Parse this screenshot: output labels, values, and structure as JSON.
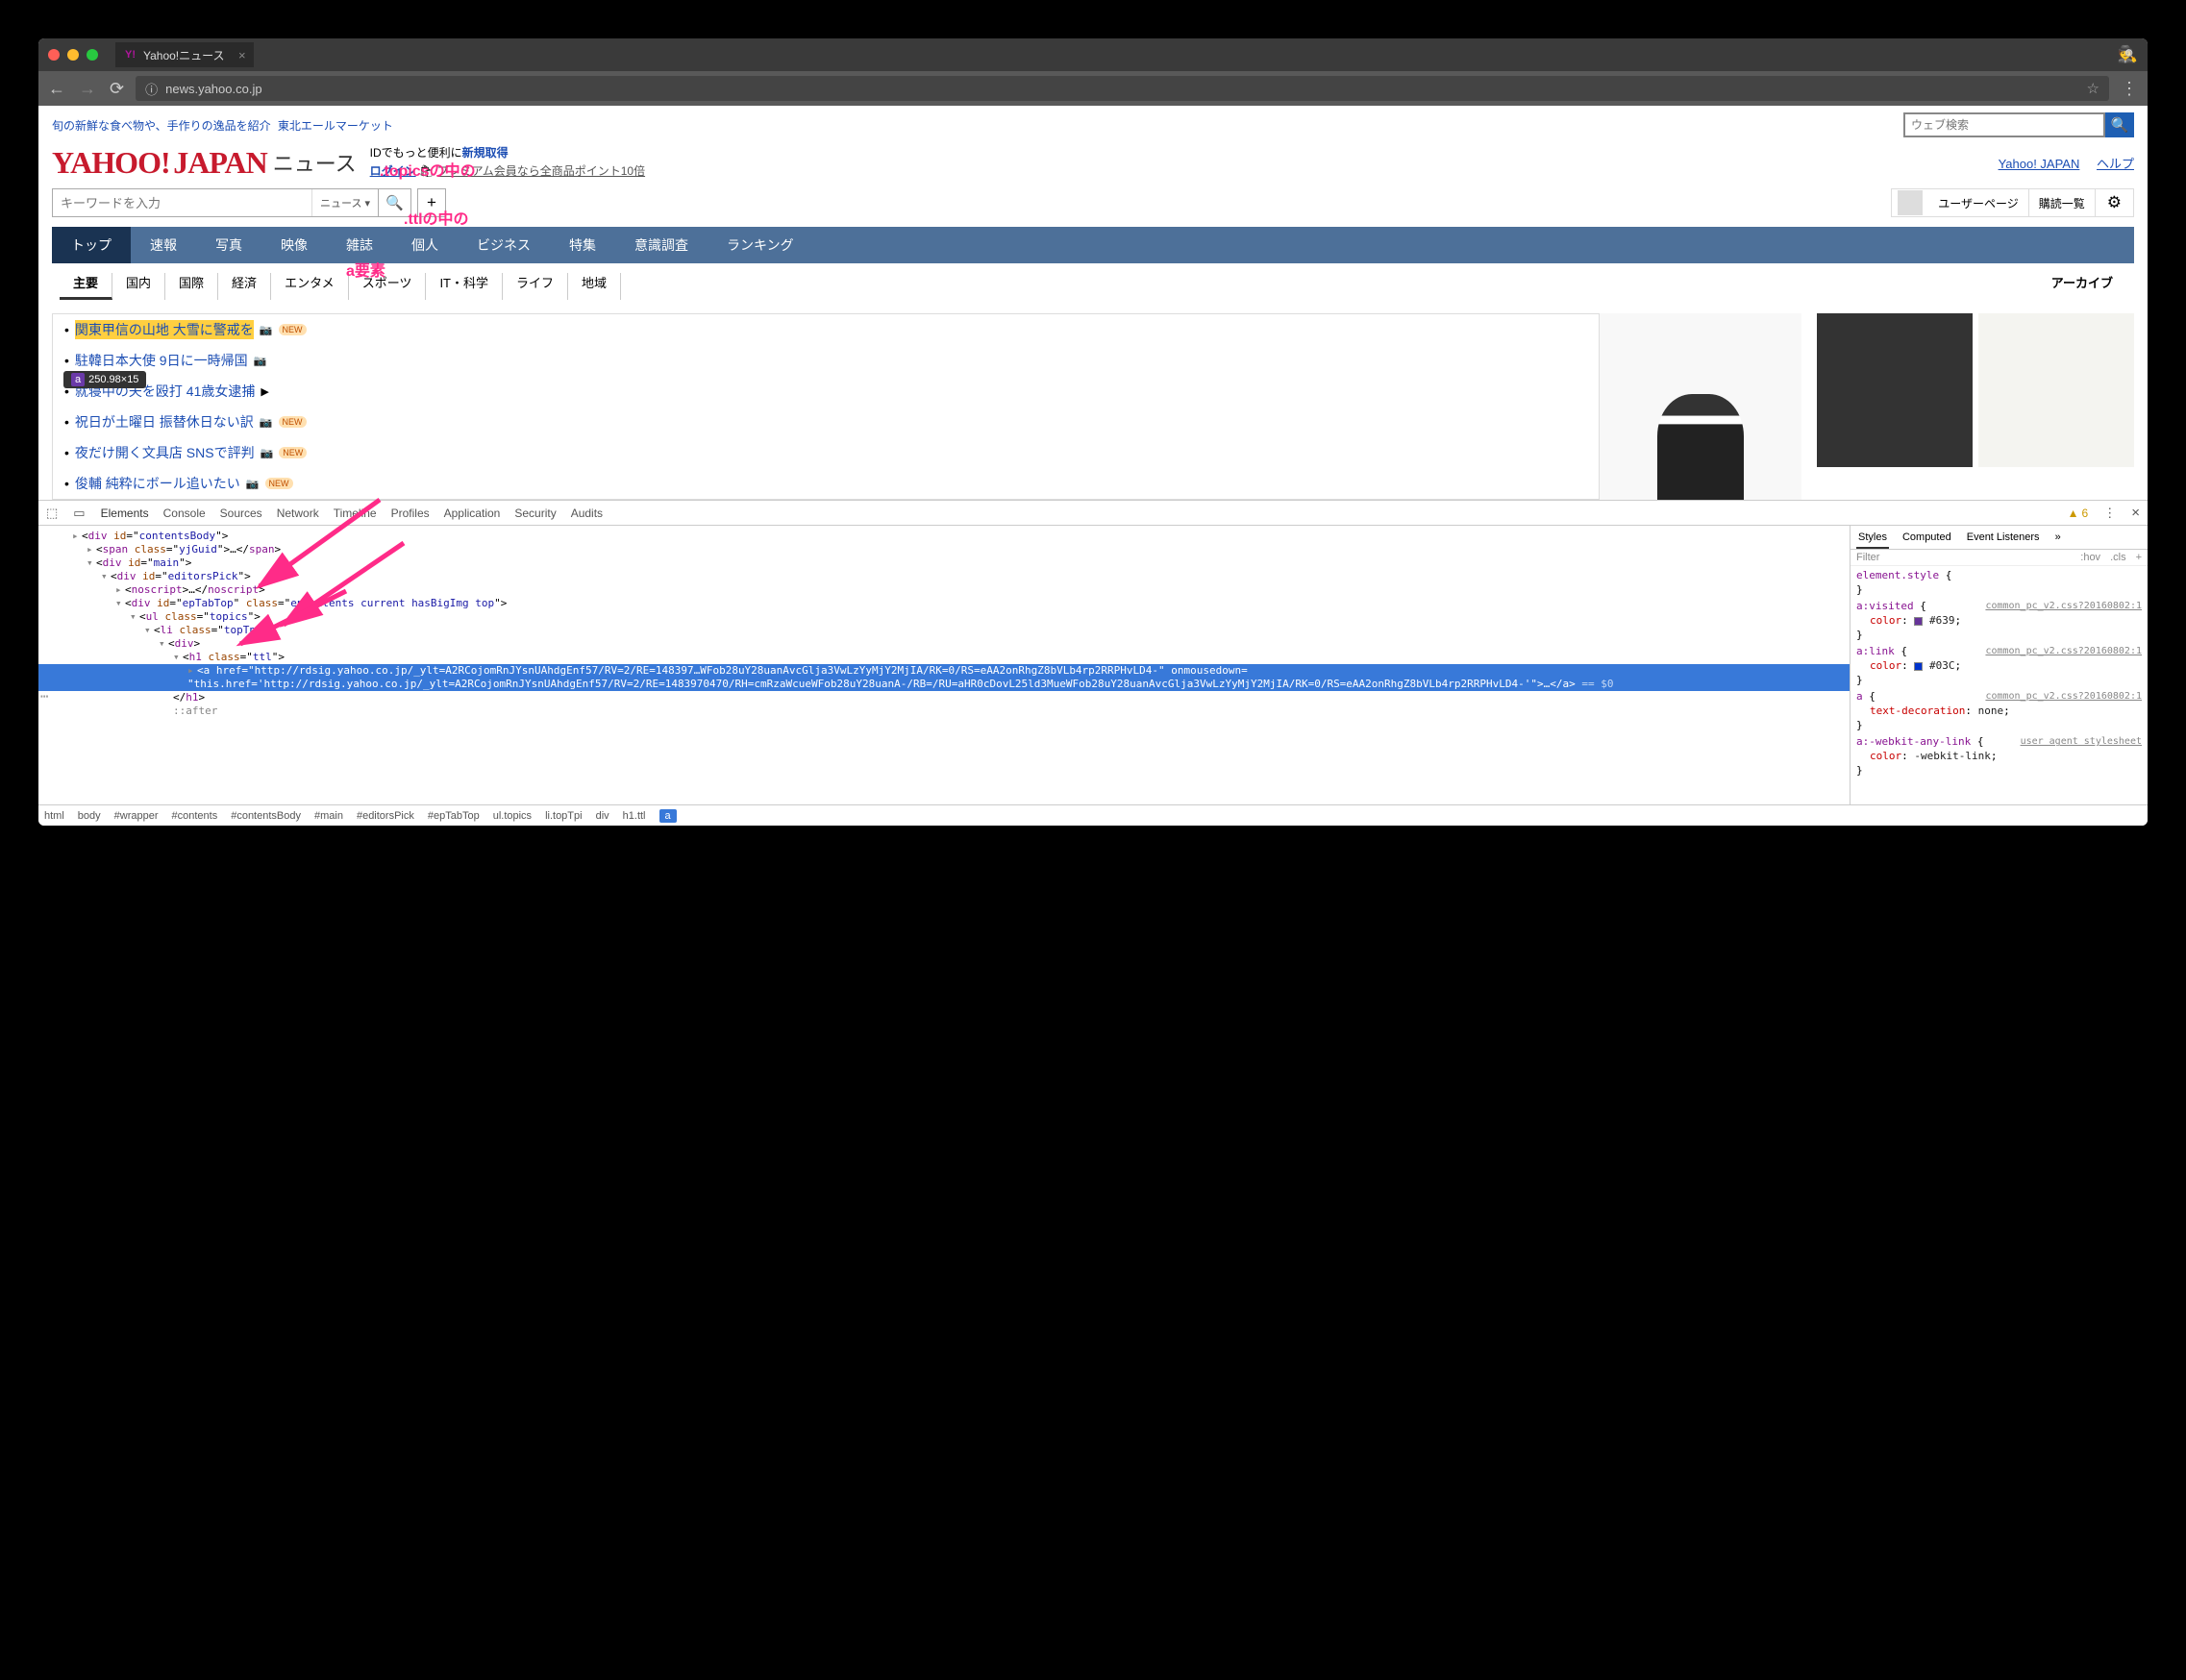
{
  "chrome": {
    "tab_title": "Yahoo!ニュース",
    "url": "news.yahoo.co.jp",
    "dots": [
      "#ff5f57",
      "#febc2e",
      "#28c840"
    ]
  },
  "top_links": [
    "旬の新鮮な食べ物や、手作りの逸品を紹介",
    "東北エールマーケット"
  ],
  "search_placeholder": "ウェブ検索",
  "logo_text": "YAHOO!",
  "logo_sub": "JAPAN",
  "news_label": "ニュース",
  "id_line1_a": "IDでもっと便利に",
  "id_line1_b": "新規取得",
  "id_line2_a": "ログイン",
  "id_line2_b": "プレミアム会員なら全商品ポイント10倍",
  "header_right": [
    "Yahoo! JAPAN",
    "ヘルプ"
  ],
  "keyword_placeholder": "キーワードを入力",
  "search_drop": "ニュース",
  "user_menu": [
    "ユーザーページ",
    "購読一覧"
  ],
  "main_nav": [
    "トップ",
    "速報",
    "写真",
    "映像",
    "雑誌",
    "個人",
    "ビジネス",
    "特集",
    "意識調査",
    "ランキング"
  ],
  "sub_nav": [
    "主要",
    "国内",
    "国際",
    "経済",
    "エンタメ",
    "スポーツ",
    "IT・科学",
    "ライフ",
    "地域"
  ],
  "archive": "アーカイブ",
  "tooltip": {
    "tag": "a",
    "dims": "250.98×15"
  },
  "news": [
    {
      "t": "関東甲信の山地 大雪に警戒を",
      "cam": true,
      "new": true,
      "sel": true
    },
    {
      "t": "駐韓日本大使 9日に一時帰国",
      "cam": true
    },
    {
      "t": "就寝中の夫を殴打 41歳女逮捕",
      "vid": true
    },
    {
      "t": "祝日が土曜日 振替休日ない訳",
      "cam": true,
      "new": true
    },
    {
      "t": "夜だけ開く文具店 SNSで評判",
      "cam": true,
      "new": true
    },
    {
      "t": "俊輔 純粋にボール追いたい",
      "cam": true,
      "new": true
    }
  ],
  "anno": {
    "a1": ".topicsの中の",
    "a2": ".ttlの中の",
    "a3": "a要素"
  },
  "devtools": {
    "tabs": [
      "Elements",
      "Console",
      "Sources",
      "Network",
      "Timeline",
      "Profiles",
      "Application",
      "Security",
      "Audits"
    ],
    "warn_count": "6",
    "side_tabs": [
      "Styles",
      "Computed",
      "Event Listeners"
    ],
    "filter": "Filter",
    "filter_r": [
      ":hov",
      ".cls",
      "+"
    ],
    "styles": [
      {
        "sel": "element.style",
        "body": []
      },
      {
        "sel": "a:visited",
        "file": "common_pc_v2.css?20160802:1",
        "body": [
          {
            "p": "color",
            "v": "#639",
            "sw": "#663399"
          }
        ]
      },
      {
        "sel": "a:link",
        "file": "common_pc_v2.css?20160802:1",
        "body": [
          {
            "p": "color",
            "v": "#03C",
            "sw": "#0033cc"
          }
        ]
      },
      {
        "sel": "a",
        "file": "common_pc_v2.css?20160802:1",
        "body": [
          {
            "p": "text-decoration",
            "v": "none"
          }
        ]
      },
      {
        "sel": "a:-webkit-any-link",
        "file": "user agent stylesheet",
        "body": [
          {
            "p": "color",
            "v": "-webkit-link"
          }
        ]
      }
    ],
    "crumbs": [
      "html",
      "body",
      "#wrapper",
      "#contents",
      "#contentsBody",
      "#main",
      "#editorsPick",
      "#epTabTop",
      "ul.topics",
      "li.topTpi",
      "div",
      "h1.ttl",
      "a"
    ],
    "dom_href": "http://rdsig.yahoo.co.jp/_ylt=A2RCojomRnJYsnUAhdgEnf57/RV=2/RE=148397…WFob28uY28uanAvcGlja3VwLzYyMjY2MjIA/RK=0/RS=eAA2onRhgZ8bVLb4rp2RRPHvLD4-",
    "dom_mouse": "this.href='http://rdsig.yahoo.co.jp/_ylt=A2RCojomRnJYsnUAhdgEnf57/RV=2/RE=1483970470/RH=cmRzaWcueWFob28uY28uanA-/RB=/RU=aHR0cDovL25ld3MueWFob28uY28uanAvcGlja3VwLzYyMjY2MjIA/RK=0/RS=eAA2onRhgZ8bVLb4rp2RRPHvLD4-'"
  }
}
